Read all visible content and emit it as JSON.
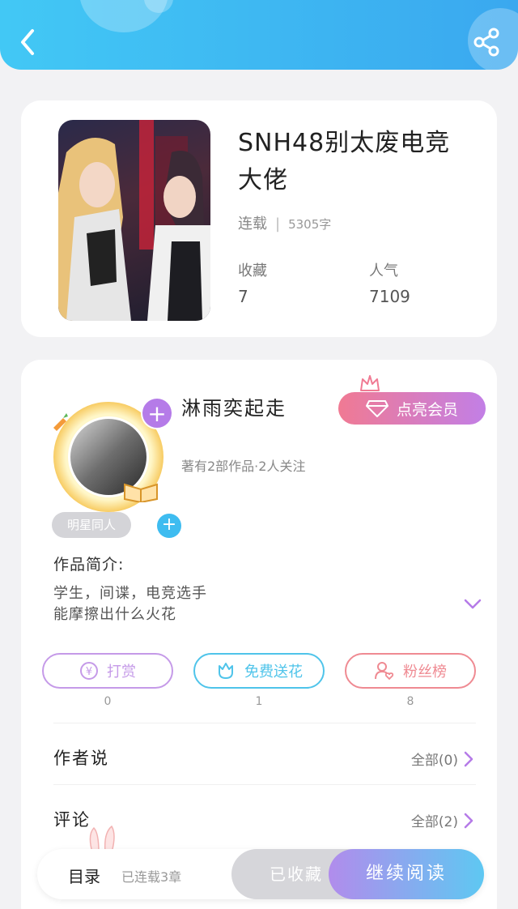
{
  "header": {
    "back_icon": "chevron-left-icon",
    "share_icon": "share-icon",
    "color_start": "#42c8f5",
    "color_end": "#3aa8ef"
  },
  "book": {
    "title": "SNH48别太废电竞大佬",
    "status": "连载",
    "word_count": "5305字",
    "favorites_label": "收藏",
    "favorites_value": "7",
    "popularity_label": "人气",
    "popularity_value": "7109"
  },
  "author": {
    "name": "淋雨奕起走",
    "meta": "著有2部作品·2人关注",
    "vip_label": "点亮会员",
    "tag": "明星同人",
    "follow_icon": "plus-icon"
  },
  "intro": {
    "label": "作品简介:",
    "line1": "学生，间谍，电竞选手",
    "line2": "能摩擦出什么火花"
  },
  "actions": {
    "reward_label": "打赏",
    "reward_count": "0",
    "flower_label": "免费送花",
    "flower_count": "1",
    "fans_label": "粉丝榜",
    "fans_count": "8"
  },
  "author_says": {
    "label": "作者说",
    "link": "全部(0)"
  },
  "comments": {
    "label": "评论",
    "link": "全部(2)"
  },
  "bottom_bar": {
    "toc_label": "目录",
    "toc_meta": "已连载3章",
    "saved_label": "已收藏",
    "read_label": "继续阅读"
  },
  "colors": {
    "accent_purple": "#b57be8",
    "accent_blue": "#3ebcf0",
    "reward_color": "#c59ae8",
    "flower_color": "#4fc4ea",
    "fans_color": "#ef8a92"
  }
}
